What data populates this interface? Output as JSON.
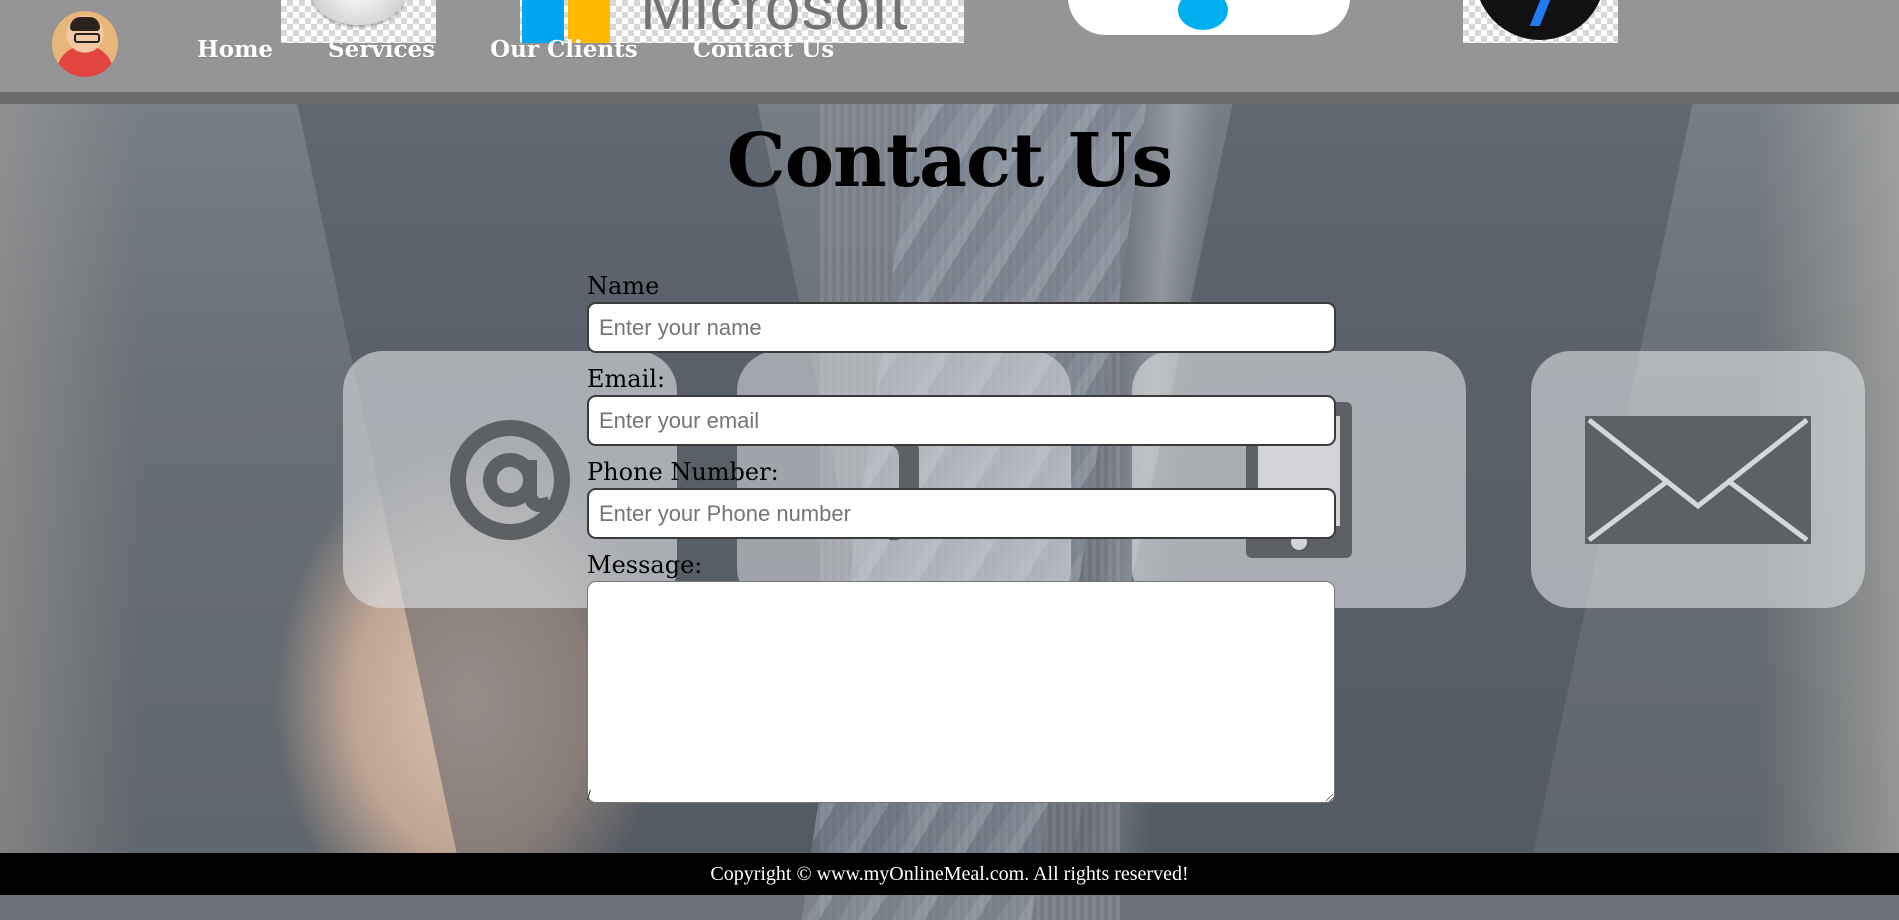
{
  "header": {
    "nav": [
      {
        "label": "Home"
      },
      {
        "label": "Services"
      },
      {
        "label": "Our Clients"
      },
      {
        "label": "Contact Us"
      }
    ],
    "client_logos": [
      "apple-logo",
      "microsoft-logo",
      "skype-logo",
      "app-logo"
    ],
    "microsoft_word": "Microsoft"
  },
  "page": {
    "title": "Contact Us"
  },
  "form": {
    "name_label": "Name",
    "name_placeholder": "Enter your name",
    "email_label": "Email:",
    "email_placeholder": "Enter your email",
    "phone_label": "Phone Number:",
    "phone_placeholder": "Enter your Phone number",
    "message_label": "Message:",
    "message_value": "",
    "trailing_text": "/"
  },
  "contact_icons": [
    "at-sign-icon",
    "phone-icon",
    "mobile-icon",
    "envelope-icon"
  ],
  "footer": {
    "copyright": "Copyright © www.myOnlineMeal.com. All rights reserved!"
  },
  "colors": {
    "header_bg": "#959595",
    "footer_bg": "#000000",
    "card_bg": "rgba(220,222,226,0.62)",
    "icon_color": "#5d6064"
  }
}
